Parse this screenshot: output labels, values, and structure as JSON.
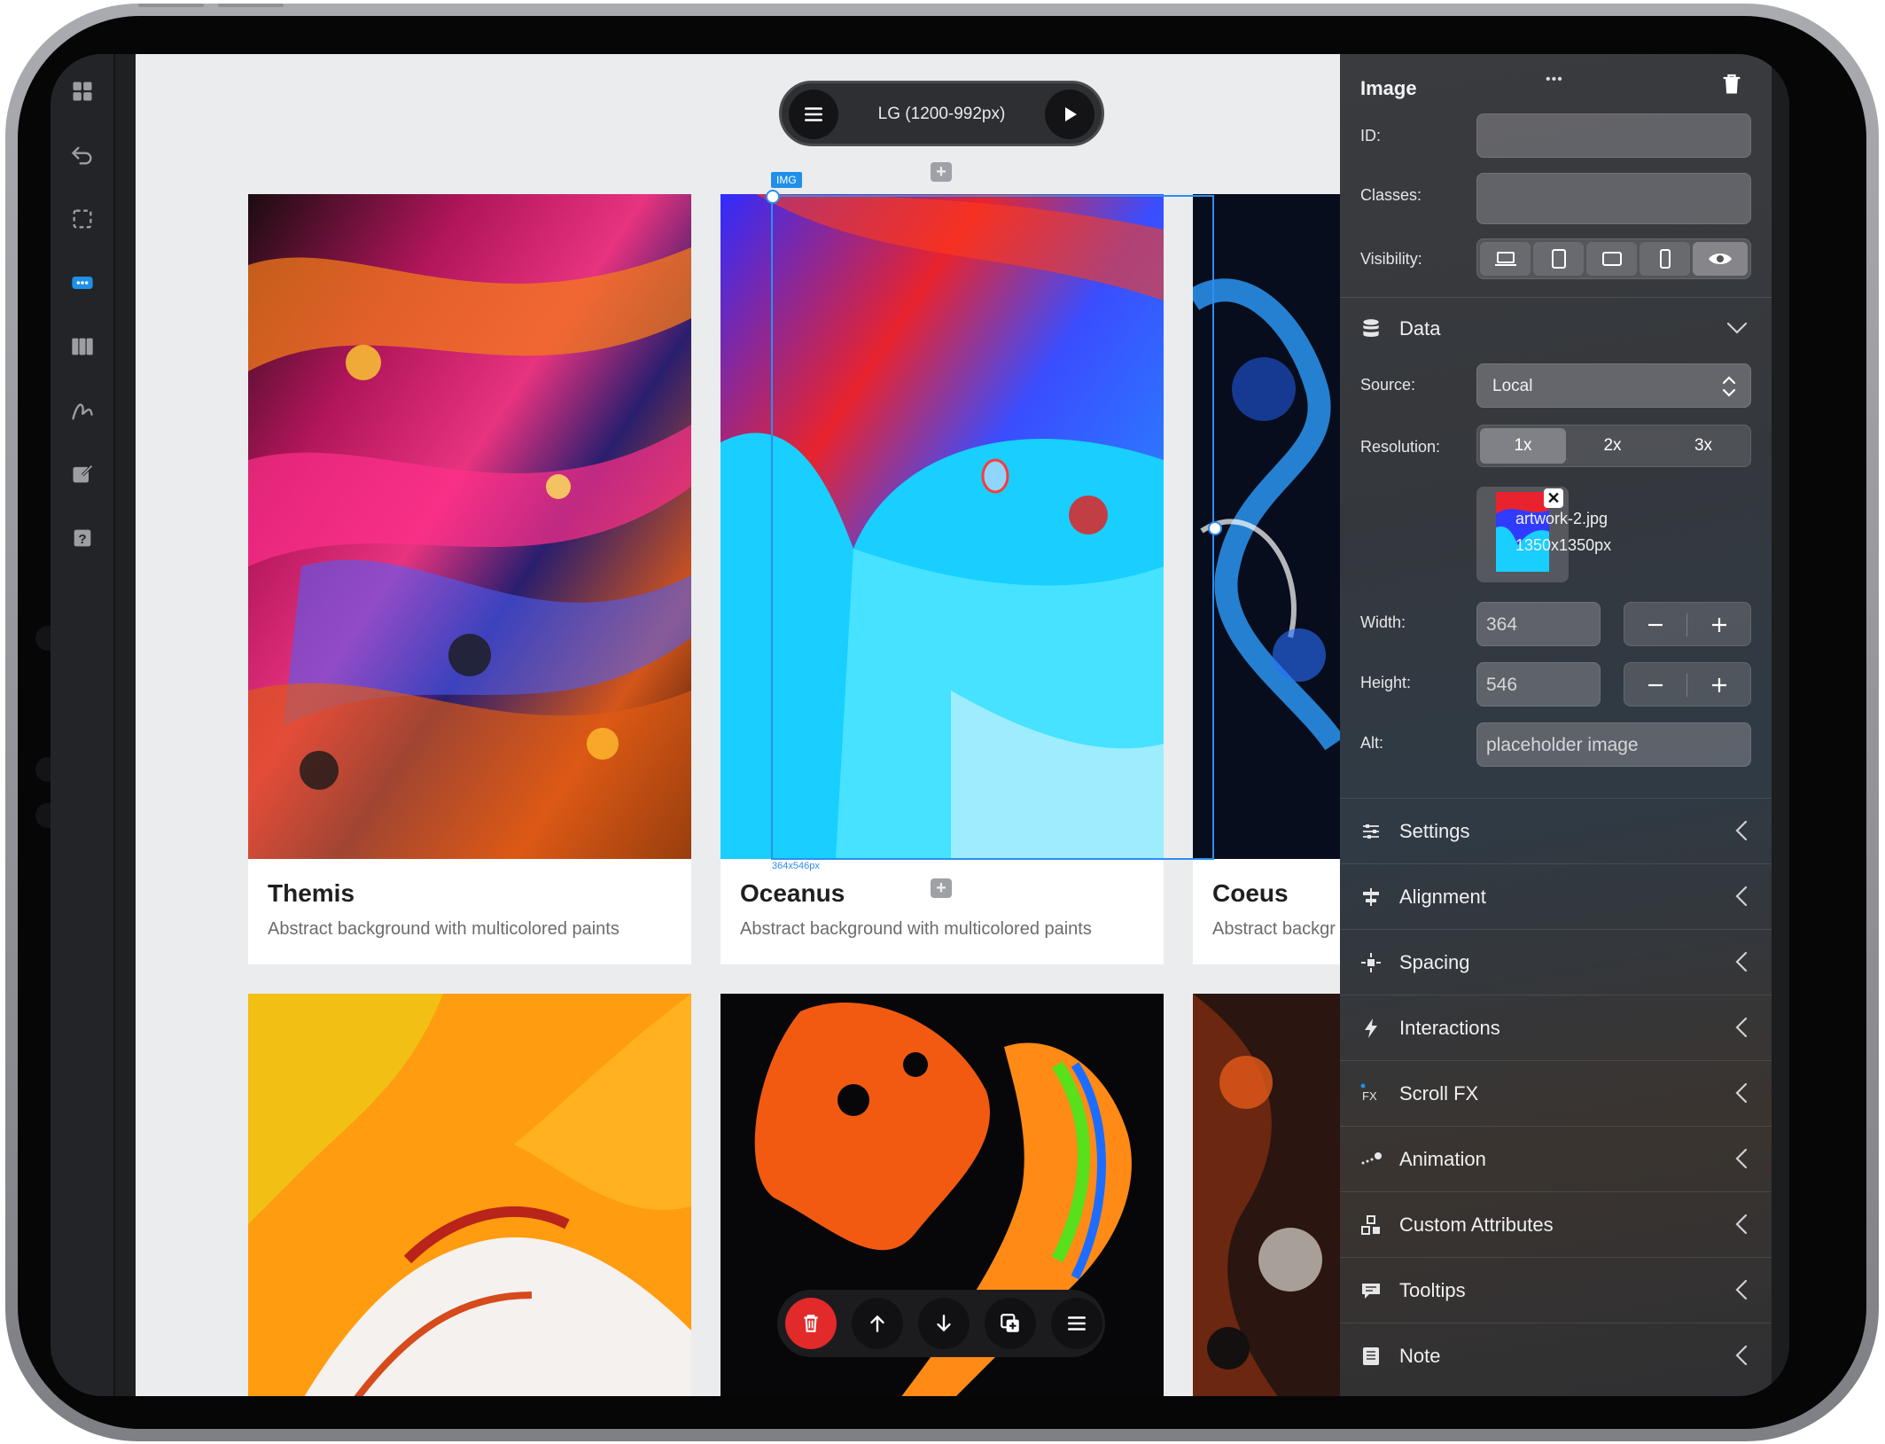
{
  "breakpoint": {
    "label": "LG (1200-992px)"
  },
  "selection": {
    "tag": "IMG",
    "size_label": "364x546px"
  },
  "cards": [
    {
      "title": "Themis",
      "description": "Abstract background with multicolored paints"
    },
    {
      "title": "Oceanus",
      "description": "Abstract background with multicolored paints"
    },
    {
      "title": "Coeus",
      "description": "Abstract backgr"
    }
  ],
  "panel": {
    "title": "Image",
    "more_label": "•••",
    "id_label": "ID:",
    "id_value": "",
    "classes_label": "Classes:",
    "classes_value": "",
    "visibility_label": "Visibility:",
    "visibility_options": [
      "desktop",
      "tablet-landscape",
      "tablet",
      "phone",
      "preview-eye"
    ],
    "data_section": {
      "label": "Data",
      "expanded": true
    },
    "source_label": "Source:",
    "source_value": "Local",
    "resolution_label": "Resolution:",
    "resolution_options": [
      "1x",
      "2x",
      "3x"
    ],
    "resolution_selected": "1x",
    "file": {
      "name": "artwork-2.jpg",
      "dimensions": "1350x1350px"
    },
    "width_label": "Width:",
    "width_value": "364",
    "height_label": "Height:",
    "height_value": "546",
    "alt_label": "Alt:",
    "alt_value": "placeholder image",
    "sections": [
      {
        "label": "Settings",
        "icon": "sliders-icon"
      },
      {
        "label": "Alignment",
        "icon": "align-center-icon"
      },
      {
        "label": "Spacing",
        "icon": "spacing-icon"
      },
      {
        "label": "Interactions",
        "icon": "lightning-icon"
      },
      {
        "label": "Scroll FX",
        "icon": "scroll-fx-icon"
      },
      {
        "label": "Animation",
        "icon": "animation-icon"
      },
      {
        "label": "Custom Attributes",
        "icon": "custom-attributes-icon"
      },
      {
        "label": "Tooltips",
        "icon": "tooltip-icon"
      },
      {
        "label": "Note",
        "icon": "note-icon"
      }
    ]
  },
  "left_toolbar": [
    "grid-icon",
    "undo-icon",
    "selection-icon",
    "more-icon",
    "columns-icon",
    "draw-icon",
    "edit-icon",
    "help-icon"
  ],
  "right_toolbar": [
    "share-icon",
    "properties-icon",
    "pages-icon",
    "layers-icon",
    "code-block-icon",
    "image-icon",
    "list-icon",
    "code-icon",
    "notes-icon"
  ],
  "action_bar": [
    "delete-icon",
    "move-up-icon",
    "move-down-icon",
    "duplicate-icon",
    "menu-icon"
  ],
  "colors": {
    "accent": "#1f8fe8",
    "delete": "#e22a2a",
    "panel": "#3a3b3f"
  }
}
